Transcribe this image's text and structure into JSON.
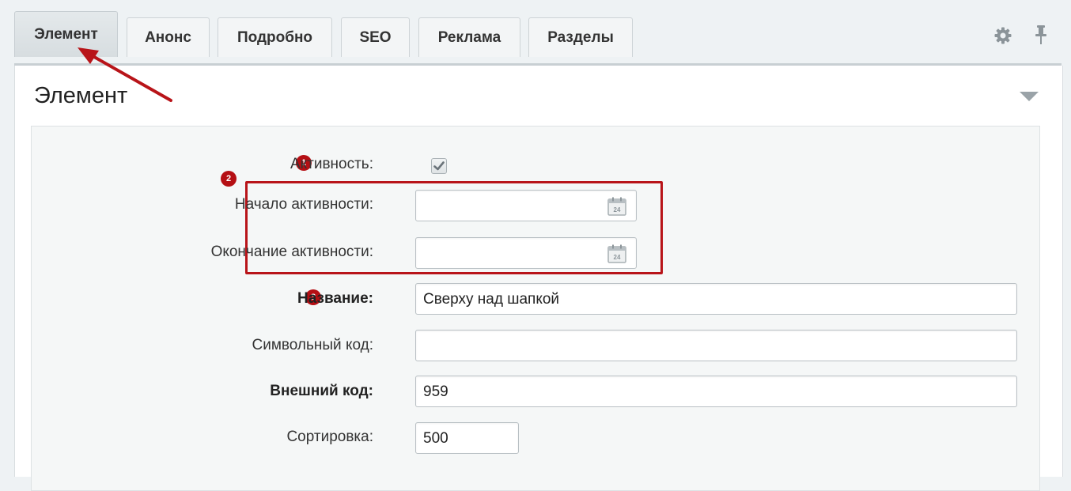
{
  "tabs": [
    {
      "label": "Элемент",
      "active": true
    },
    {
      "label": "Анонс",
      "active": false
    },
    {
      "label": "Подробно",
      "active": false
    },
    {
      "label": "SEO",
      "active": false
    },
    {
      "label": "Реклама",
      "active": false
    },
    {
      "label": "Разделы",
      "active": false
    }
  ],
  "toolbar_icons": [
    "gear-icon",
    "pin-icon"
  ],
  "section": {
    "title": "Элемент",
    "collapse_icon": "triangle-down-icon"
  },
  "form": {
    "active": {
      "label": "Активность:",
      "checked": true,
      "badge": "1"
    },
    "active_from": {
      "label": "Начало активности:",
      "value": "",
      "icon": "calendar-icon",
      "icon_text": "24"
    },
    "active_to": {
      "label": "Окончание активности:",
      "value": "",
      "icon": "calendar-icon",
      "icon_text": "24"
    },
    "dates_badge": "2",
    "name": {
      "label": "Название:",
      "value": "Сверху над шапкой",
      "badge": "3"
    },
    "code": {
      "label": "Символьный код:",
      "value": ""
    },
    "external_code": {
      "label": "Внешний код:",
      "value": "959"
    },
    "sort": {
      "label": "Сортировка:",
      "value": "500"
    }
  },
  "colors": {
    "accent_red": "#b81419",
    "page_bg": "#eef2f4",
    "panel_bg": "#ffffff",
    "inner_bg": "#f5f7f7"
  }
}
